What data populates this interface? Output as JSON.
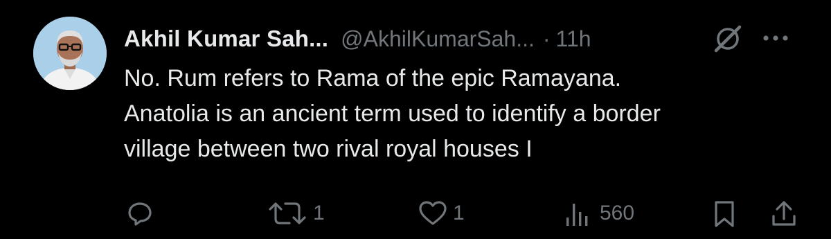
{
  "tweet": {
    "author": {
      "display_name": "Akhil Kumar Sah...",
      "handle": "@AkhilKumarSah...",
      "separator": "·",
      "timestamp": "11h"
    },
    "text_lines": [
      "No. Rum refers to Rama of the epic Ramayana.",
      "Anatolia is an ancient term used to identify a border",
      "village between two rival royal houses I"
    ],
    "actions": {
      "reply_count": "",
      "retweet_count": "1",
      "like_count": "1",
      "views_count": "560"
    },
    "icons": {
      "reply": "reply-icon",
      "retweet": "retweet-icon",
      "like": "heart-icon",
      "views": "views-icon",
      "bookmark": "bookmark-icon",
      "share": "share-icon",
      "grok": "grok-icon",
      "more": "more-icon"
    },
    "colors": {
      "background": "#000000",
      "primary_text": "#e7e9ea",
      "secondary_text": "#71767b"
    }
  }
}
